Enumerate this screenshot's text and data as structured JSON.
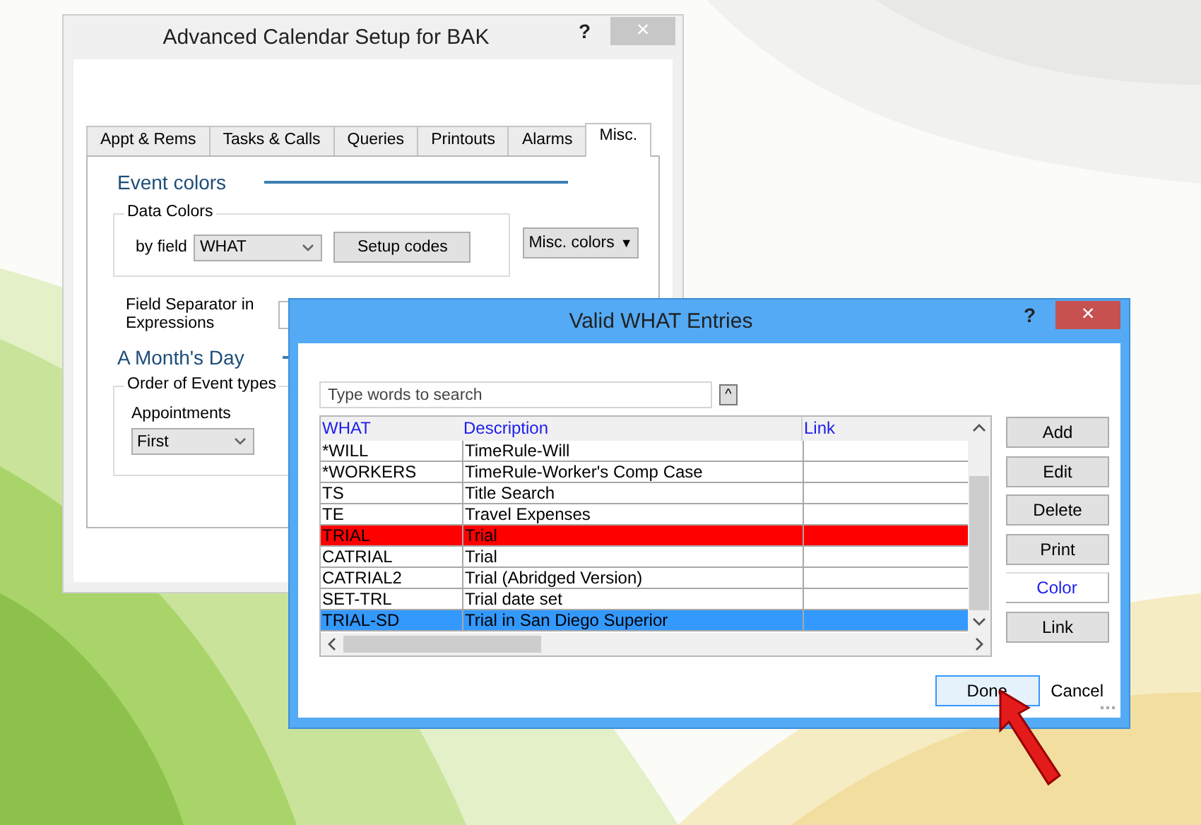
{
  "setup_window": {
    "title": "Advanced Calendar Setup for BAK",
    "help": "?",
    "close": "×",
    "tabs": [
      {
        "label": "Appt & Rems",
        "selected": false
      },
      {
        "label": "Tasks & Calls",
        "selected": false
      },
      {
        "label": "Queries",
        "selected": false
      },
      {
        "label": "Printouts",
        "selected": false
      },
      {
        "label": "Alarms",
        "selected": false
      },
      {
        "label": "Misc.",
        "selected": true
      }
    ],
    "event_colors": {
      "heading": "Event colors",
      "group_label": "Data Colors",
      "field_label": "by field",
      "field_value": "WHAT",
      "setup_button": "Setup codes",
      "misc_button": "Misc. colors",
      "misc_caret": "▼"
    },
    "separator_label": "Field Separator in Expressions",
    "months_day": {
      "heading": "A Month's Day",
      "group_label": "Order of Event types",
      "field_label": "Appointments",
      "field_value": "First"
    }
  },
  "entries_dialog": {
    "title": "Valid WHAT Entries",
    "help": "?",
    "close": "×",
    "search": {
      "placeholder": "Type words to search"
    },
    "collapse": "^",
    "table": {
      "columns": [
        "WHAT",
        "Description",
        "Link"
      ],
      "rows": [
        {
          "what": "*WILL",
          "description": "TimeRule-Will",
          "selected": false
        },
        {
          "what": "*WORKERS",
          "description": "TimeRule-Worker's Comp Case",
          "selected": false
        },
        {
          "what": "TS",
          "description": "Title Search",
          "selected": false
        },
        {
          "what": "TE",
          "description": "Travel Expenses",
          "selected": false
        },
        {
          "what": "TRIAL",
          "description": "Trial",
          "selected": false,
          "color": "#ff0000"
        },
        {
          "what": "CATRIAL",
          "description": "Trial",
          "selected": false
        },
        {
          "what": "CATRIAL2",
          "description": "Trial (Abridged Version)",
          "selected": false
        },
        {
          "what": "SET-TRL",
          "description": "Trial date set",
          "selected": false
        },
        {
          "what": "TRIAL-SD",
          "description": "Trial in San Diego Superior",
          "selected": true
        }
      ]
    },
    "side_buttons": [
      {
        "label": "Add",
        "kind": "push"
      },
      {
        "label": "Edit",
        "kind": "push"
      },
      {
        "label": "Delete",
        "kind": "push"
      },
      {
        "label": "Print",
        "kind": "push"
      },
      {
        "label": "Color",
        "kind": "flat"
      },
      {
        "label": "Link",
        "kind": "push"
      }
    ],
    "done_button": "Done",
    "cancel_button": "Cancel"
  }
}
